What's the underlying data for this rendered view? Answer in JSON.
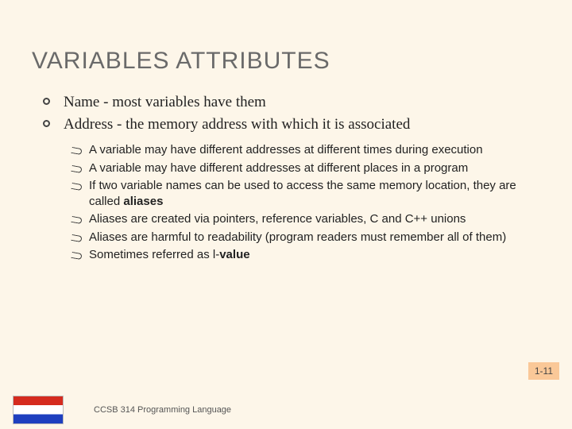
{
  "title": "VARIABLES ATTRIBUTES",
  "bullets": {
    "b1": "Name - most variables have them",
    "b2": "Address - the memory address with which it is associated"
  },
  "sub": {
    "s1": "A variable may have different addresses at different times during execution",
    "s2": "A variable may have different addresses at different places in a program",
    "s3a": "If two variable names can be used to access the same memory location, they are called ",
    "s3b": "aliases",
    "s4": "Aliases are created via pointers, reference variables, C and C++ unions",
    "s5": "Aliases are harmful to readability (program readers must remember all of them)",
    "s6a": "Sometimes referred as l-",
    "s6b": "value"
  },
  "pageNumber": "1-11",
  "footer": "CCSB 314 Programming Language"
}
